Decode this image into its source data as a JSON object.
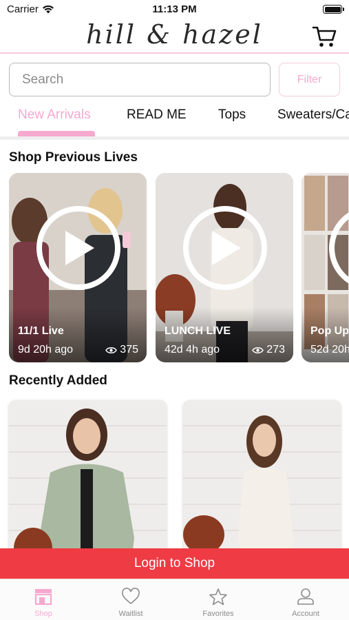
{
  "status": {
    "carrier": "Carrier",
    "time": "11:13 PM"
  },
  "header": {
    "logo": "hill & hazel",
    "cart_icon": "cart-icon"
  },
  "search": {
    "placeholder": "Search",
    "filter_label": "Filter"
  },
  "tabs": [
    {
      "label": "New Arrivals",
      "active": true
    },
    {
      "label": "READ ME",
      "active": false
    },
    {
      "label": "Tops",
      "active": false
    },
    {
      "label": "Sweaters/Ca",
      "active": false
    }
  ],
  "sections": {
    "previous_lives": "Shop Previous Lives",
    "recently_added": "Recently Added"
  },
  "lives": [
    {
      "title": "11/1 Live",
      "ago": "9d 20h ago",
      "views": "375"
    },
    {
      "title": "LUNCH LIVE",
      "ago": "42d 4h ago",
      "views": "273"
    },
    {
      "title": "Pop Up",
      "ago": "52d 20h",
      "views": ""
    }
  ],
  "login": {
    "label": "Login to Shop"
  },
  "nav": [
    {
      "label": "Shop",
      "icon": "shop-icon",
      "active": true
    },
    {
      "label": "Waitlist",
      "icon": "heart-icon",
      "active": false
    },
    {
      "label": "Favorites",
      "icon": "star-icon",
      "active": false
    },
    {
      "label": "Account",
      "icon": "account-icon",
      "active": false
    }
  ],
  "colors": {
    "accent_pink": "#f7a8cf",
    "login_red": "#ee3b44",
    "divider_pink": "#f3c9de"
  }
}
